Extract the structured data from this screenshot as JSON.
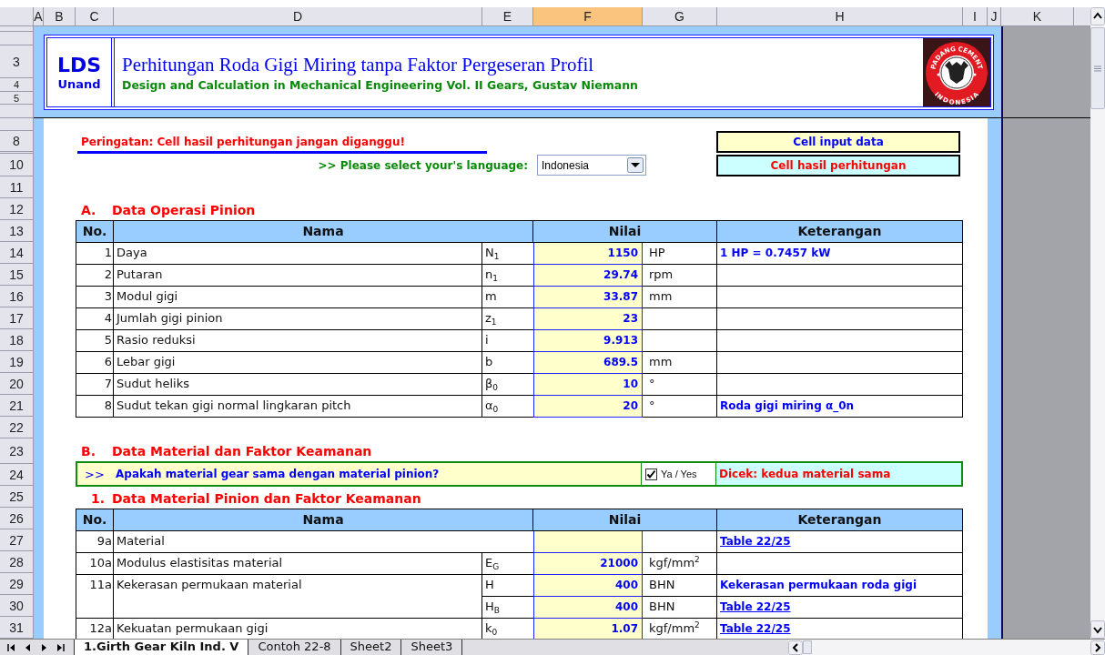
{
  "column_headers": [
    {
      "label": "A",
      "selected": false
    },
    {
      "label": "B",
      "selected": false
    },
    {
      "label": "C",
      "selected": false
    },
    {
      "label": "D",
      "selected": false
    },
    {
      "label": "E",
      "selected": false
    },
    {
      "label": "F",
      "selected": true
    },
    {
      "label": "G",
      "selected": false
    },
    {
      "label": "H",
      "selected": false
    },
    {
      "label": "I",
      "selected": false
    },
    {
      "label": "J",
      "selected": false
    },
    {
      "label": "K",
      "selected": false
    }
  ],
  "row_headers": [
    "3",
    "4",
    "5",
    "8",
    "10",
    "11",
    "12",
    "13",
    "14",
    "15",
    "16",
    "17",
    "18",
    "19",
    "20",
    "21",
    "22",
    "23",
    "24",
    "25",
    "26",
    "27",
    "28",
    "29",
    "30",
    "31"
  ],
  "banner": {
    "logo_title": "LDS",
    "logo_subtitle": "Unand",
    "title": "Perhitungan Roda Gigi Miring tanpa Faktor Pergeseran Profil",
    "subtitle": "Design and Calculation in Mechanical Engineering Vol. II Gears, Gustav Niemann",
    "emblem_top": "PADANG CEMENT",
    "emblem_bottom": "INDONESIA"
  },
  "warning": "Peringatan: Cell hasil perhitungan jangan diganggu!",
  "legend": [
    {
      "kind": "input",
      "label": "Cell input data"
    },
    {
      "kind": "result",
      "label": "Cell hasil perhitungan"
    }
  ],
  "language": {
    "prompt": ">> Please select your's language:",
    "value": "Indonesia"
  },
  "section_a": {
    "letter": "A.",
    "title": "Data Operasi Pinion",
    "columns": [
      "No.",
      "Nama",
      "Nilai",
      "Keterangan"
    ],
    "rows": [
      {
        "no": "1",
        "name": "Daya",
        "lines": [
          {
            "symbol": "N$_{1}$",
            "value": "1150",
            "unit": "HP",
            "note": "1 HP = 0.7457 kW"
          }
        ]
      },
      {
        "no": "2",
        "name": "Putaran",
        "lines": [
          {
            "symbol": "n$_{1}$",
            "value": "29.74",
            "unit": "rpm"
          }
        ]
      },
      {
        "no": "3",
        "name": "Modul gigi",
        "lines": [
          {
            "symbol": "m",
            "value": "33.87",
            "unit": "mm"
          }
        ]
      },
      {
        "no": "4",
        "name": "Jumlah gigi pinion",
        "lines": [
          {
            "symbol": "z$_{1}$",
            "value": "23"
          }
        ]
      },
      {
        "no": "5",
        "name": "Rasio reduksi",
        "lines": [
          {
            "symbol": "i",
            "value": "9.913"
          }
        ]
      },
      {
        "no": "6",
        "name": "Lebar gigi",
        "lines": [
          {
            "symbol": "b",
            "value": "689.5",
            "unit": "mm"
          }
        ]
      },
      {
        "no": "7",
        "name": "Sudut heliks",
        "lines": [
          {
            "symbol": "β$_{0}$",
            "value": "10",
            "unit": "°"
          }
        ]
      },
      {
        "no": "8",
        "name": "Sudut tekan gigi normal lingkaran pitch",
        "lines": [
          {
            "symbol": "α$_{0}$",
            "value": "20",
            "unit": "°",
            "note": "Roda gigi miring α_0n"
          }
        ]
      }
    ]
  },
  "section_b": {
    "letter": "B.",
    "title": "Data Material dan Faktor Keamanan",
    "question": {
      "marker": ">>",
      "text": "Apakah material gear sama dengan material pinion?",
      "option": "Ya / Yes",
      "checked": true,
      "result": "Dicek: kedua material sama"
    },
    "subsection": {
      "number": "1.",
      "title": "Data Material Pinion dan Faktor Keamanan"
    },
    "columns": [
      "No.",
      "Nama",
      "Nilai",
      "Keterangan"
    ],
    "rows": [
      {
        "no": "9a",
        "name": "Material",
        "lines": [
          {
            "link": "Table 22/25"
          }
        ]
      },
      {
        "no": "10a",
        "name": "Modulus elastisitas material",
        "lines": [
          {
            "symbol": "E$_{G}$",
            "value": "21000",
            "unit": "kgf/mm$^{2}$"
          }
        ]
      },
      {
        "no": "11a",
        "name": "Kekerasan permukaan material",
        "lines": [
          {
            "symbol": "H",
            "value": "400",
            "unit": "BHN",
            "note": "Kekerasan permukaan roda gigi"
          },
          {
            "symbol": "H$_{B}$",
            "value": "400",
            "unit": "BHN",
            "link": "Table 22/25"
          }
        ]
      },
      {
        "no": "12a",
        "name": "Kekuatan permukaan gigi",
        "lines": [
          {
            "symbol": "k$_{0}$",
            "value": "1.07",
            "unit": "kgf/mm$^{2}$",
            "link": "Table 22/25"
          }
        ]
      }
    ]
  },
  "sheet_tabs": [
    {
      "label": "1.Girth Gear Kiln Ind. V",
      "selected": true
    },
    {
      "label": "Contoh 22-8",
      "selected": false
    },
    {
      "label": "Sheet2",
      "selected": false
    },
    {
      "label": "Sheet3",
      "selected": false
    }
  ]
}
